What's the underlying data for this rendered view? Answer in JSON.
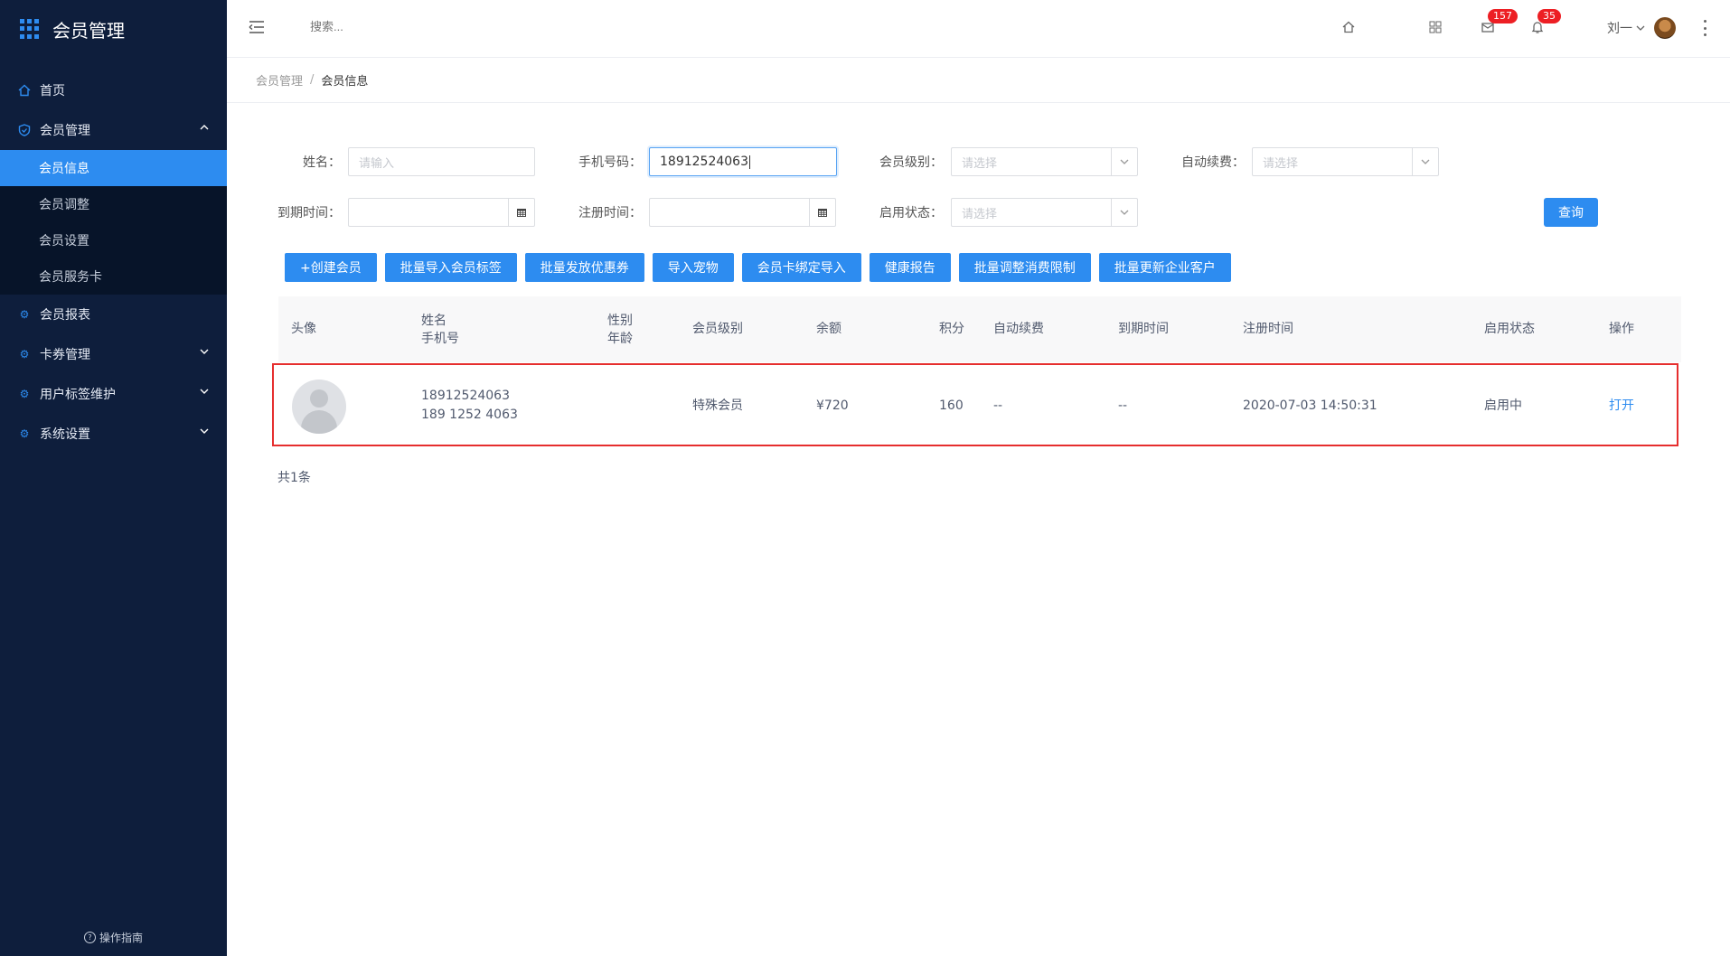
{
  "app": {
    "title": "会员管理"
  },
  "sidebar": {
    "items": [
      {
        "label": "首页",
        "icon": "home-icon"
      },
      {
        "label": "会员管理",
        "icon": "shield-icon",
        "expanded": true,
        "children": [
          "会员信息",
          "会员调整",
          "会员设置",
          "会员服务卡"
        ],
        "active_child": "会员信息"
      },
      {
        "label": "会员报表",
        "icon": "gear-icon"
      },
      {
        "label": "卡券管理",
        "icon": "gear-icon"
      },
      {
        "label": "用户标签维护",
        "icon": "gear-icon"
      },
      {
        "label": "系统设置",
        "icon": "gear-icon"
      }
    ],
    "help": "操作指南"
  },
  "header": {
    "search_placeholder": "搜索...",
    "mail_badge": "157",
    "bell_badge": "35",
    "user_name": "刘一"
  },
  "breadcrumb": {
    "parent": "会员管理",
    "separator": "/",
    "current": "会员信息"
  },
  "filters": {
    "name_label": "姓名：",
    "name_placeholder": "请输入",
    "phone_label": "手机号码：",
    "phone_value": "18912524063",
    "level_label": "会员级别：",
    "level_placeholder": "请选择",
    "renew_label": "自动续费：",
    "renew_placeholder": "请选择",
    "expire_label": "到期时间：",
    "register_label": "注册时间：",
    "status_label": "启用状态：",
    "status_placeholder": "请选择",
    "query_button": "查询"
  },
  "actions": [
    "+创建会员",
    "批量导入会员标签",
    "批量发放优惠券",
    "导入宠物",
    "会员卡绑定导入",
    "健康报告",
    "批量调整消费限制",
    "批量更新企业客户"
  ],
  "table": {
    "headers": {
      "avatar": "头像",
      "name": "姓名",
      "phone": "手机号",
      "gender": "性别",
      "age": "年龄",
      "level": "会员级别",
      "balance": "余额",
      "points": "积分",
      "auto_renew": "自动续费",
      "expire": "到期时间",
      "register": "注册时间",
      "status": "启用状态",
      "op": "操作"
    },
    "rows": [
      {
        "name": "18912524063",
        "phone": "189 1252 4063",
        "level": "特殊会员",
        "balance": "¥720",
        "points": "160",
        "auto_renew": "--",
        "expire": "--",
        "register": "2020-07-03 14:50:31",
        "status": "启用中",
        "op": "打开"
      }
    ],
    "total": "共1条"
  },
  "colors": {
    "sidebar_bg": "#0e1e3c",
    "accent": "#2d8cf0",
    "badge": "#ed1f24",
    "highlight_border": "#e62e2e"
  }
}
